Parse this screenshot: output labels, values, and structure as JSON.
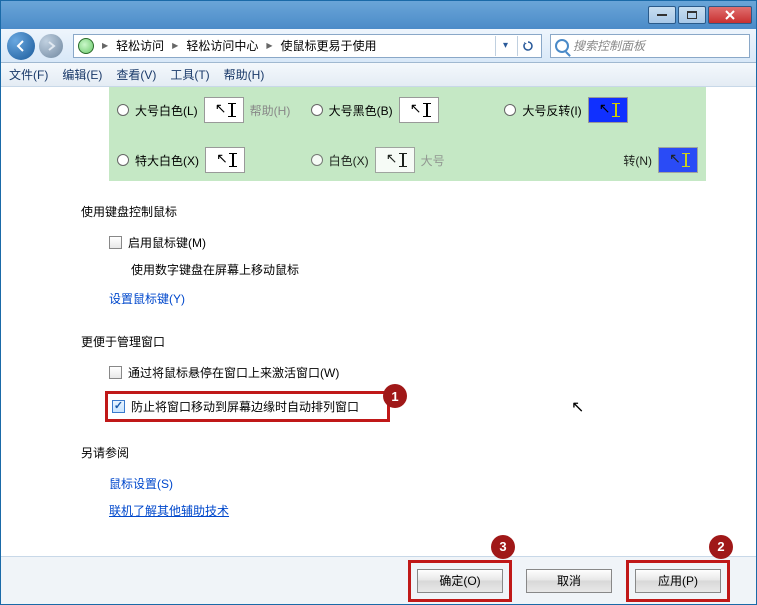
{
  "titlebar": {
    "min_icon": "minimize-icon",
    "max_icon": "maximize-icon",
    "close_icon": "close-icon"
  },
  "nav": {
    "back_icon": "back-icon",
    "fwd_icon": "forward-icon",
    "crumb1": "轻松访问",
    "crumb2": "轻松访问中心",
    "crumb3": "使鼠标更易于使用",
    "refresh_icon": "refresh-icon",
    "dropdown_icon": "chevron-down-icon"
  },
  "search": {
    "placeholder": "搜索控制面板"
  },
  "menu": {
    "file": "文件(F)",
    "edit": "编辑(E)",
    "view": "查看(V)",
    "tools": "工具(T)",
    "help": "帮助(H)"
  },
  "cursors": {
    "r1c1": "大号白色(L)",
    "r1c2": "大号黑色(B)",
    "r1c2_extra": "帮助(H)",
    "r1c3": "大号反转(I)",
    "r2c1": "特大白色(X)",
    "r2c2": "白色(X)",
    "r2c3_partial": "转(N)",
    "ghost": "大号"
  },
  "sections": {
    "keyboard_title": "使用键盘控制鼠标",
    "mousekeys_label": "启用鼠标键(M)",
    "mousekeys_desc": "使用数字键盘在屏幕上移动鼠标",
    "mousekeys_link": "设置鼠标键(Y)",
    "windowmgmt_title": "更便于管理窗口",
    "hover_label": "通过将鼠标悬停在窗口上来激活窗口(W)",
    "prevent_label": "防止将窗口移动到屏幕边缘时自动排列窗口",
    "seealso_title": "另请参阅",
    "mousesettings_link": "鼠标设置(S)",
    "online_link": "联机了解其他辅助技术"
  },
  "callouts": {
    "c1": "1",
    "c2": "2",
    "c3": "3"
  },
  "buttons": {
    "ok": "确定(O)",
    "cancel": "取消",
    "apply": "应用(P)"
  }
}
